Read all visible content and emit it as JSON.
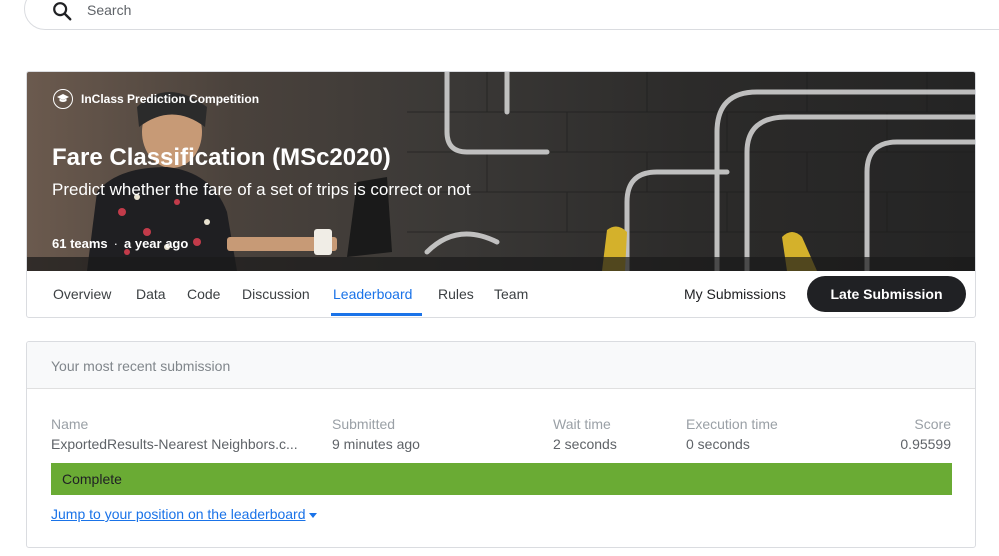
{
  "search": {
    "placeholder": "Search"
  },
  "competition": {
    "badge": "InClass Prediction Competition",
    "title": "Fare Classification (MSc2020)",
    "subtitle": "Predict whether the fare of a set of trips is correct or not",
    "teams": "61 teams",
    "separator": "·",
    "age": "a year ago"
  },
  "tabs": [
    "Overview",
    "Data",
    "Code",
    "Discussion",
    "Leaderboard",
    "Rules",
    "Team"
  ],
  "active_tab": "Leaderboard",
  "actions": {
    "my_submissions": "My Submissions",
    "late_submission": "Late Submission"
  },
  "submission": {
    "header": "Your most recent submission",
    "columns": {
      "name": "Name",
      "submitted": "Submitted",
      "wait": "Wait time",
      "execution": "Execution time",
      "score": "Score"
    },
    "values": {
      "name": "ExportedResults-Nearest Neighbors.c...",
      "submitted": "9 minutes ago",
      "wait": "2 seconds",
      "execution": "0 seconds",
      "score": "0.95599"
    },
    "status": "Complete",
    "status_color": "#6aab34",
    "jump_link": "Jump to your position on the leaderboard"
  },
  "colors": {
    "accent": "#1a73e8",
    "dark_button": "#202124"
  }
}
